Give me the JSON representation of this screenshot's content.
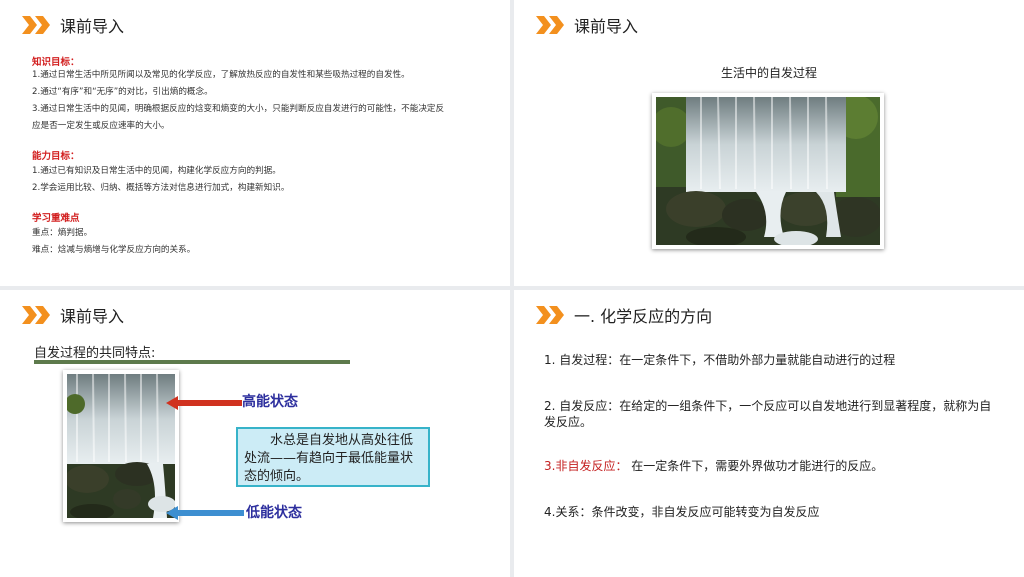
{
  "slide1": {
    "title": "课前导入",
    "knowledge_heading": "知识目标：",
    "knowledge_lines": [
      "1.通过日常生活中所见所闻以及常见的化学反应，了解放热反应的自发性和某些吸热过程的自发性。",
      "2.通过“有序”和“无序”的对比，引出熵的概念。",
      "3.通过日常生活中的见闻，明确根据反应的焓变和熵变的大小，只能判断反应自发进行的可能性，不能决定反",
      "应是否一定发生或反应速率的大小。"
    ],
    "ability_heading": "能力目标：",
    "ability_lines": [
      "1.通过已有知识及日常生活中的见闻，构建化学反应方向的判据。",
      "2.学会运用比较、归纳、概括等方法对信息进行加式，构建新知识。"
    ],
    "key_heading": "学习重难点",
    "key_lines": [
      "重点：熵判据。",
      "难点：焓减与熵增与化学反应方向的关系。"
    ]
  },
  "slide2": {
    "title": "课前导入",
    "caption": "生活中的自发过程"
  },
  "slide3": {
    "title": "课前导入",
    "subtitle": "自发过程的共同特点:",
    "high_label": "高能状态",
    "low_label": "低能状态",
    "callout": "　　水总是自发地从高处往低处流——有趋向于最低能量状态的倾向。"
  },
  "slide4": {
    "title": "一. 化学反应的方向",
    "item1": "1. 自发过程：在一定条件下，不借助外部力量就能自动进行的过程",
    "item2": "2. 自发反应：在给定的一组条件下，一个反应可以自发地进行到显著程度，就称为自发反应。",
    "item3_label": "3.非自发反应：",
    "item3_text": " 在一定条件下，需要外界做功才能进行的反应。",
    "item4": "4.关系：条件改变，非自发反应可能转变为自发反应"
  },
  "colors": {
    "accent_orange": "#f3901e",
    "heading_red": "#d21f1f",
    "label_blue": "#2d2f9e",
    "callout_bg": "#ccecf6",
    "callout_border": "#37b3c9",
    "rule_green": "#5d7a4c"
  }
}
